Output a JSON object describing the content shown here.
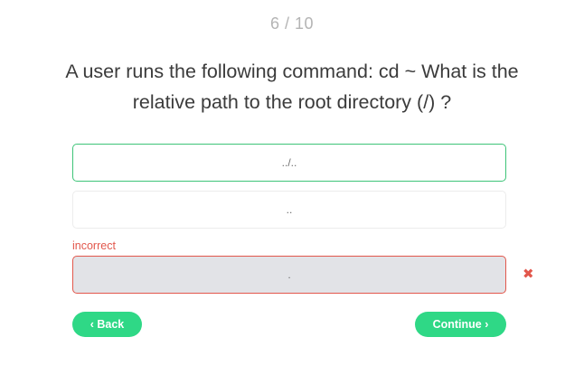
{
  "progress": {
    "text": "6 / 10"
  },
  "question": {
    "text": "A user runs the following command: cd ~ What is the relative path to the root directory (/) ?"
  },
  "options": [
    {
      "label": "../..",
      "state": "correct"
    },
    {
      "label": "..",
      "state": "neutral"
    },
    {
      "label": ".",
      "state": "incorrect"
    }
  ],
  "feedback": {
    "incorrect_label": "incorrect",
    "wrong_icon": "✖"
  },
  "navigation": {
    "back_label": "‹ Back",
    "continue_label": "Continue ›"
  },
  "colors": {
    "accent": "#2fd886",
    "correct_border": "#3ec478",
    "error": "#e2574c",
    "selected_background": "#e2e3e7"
  }
}
